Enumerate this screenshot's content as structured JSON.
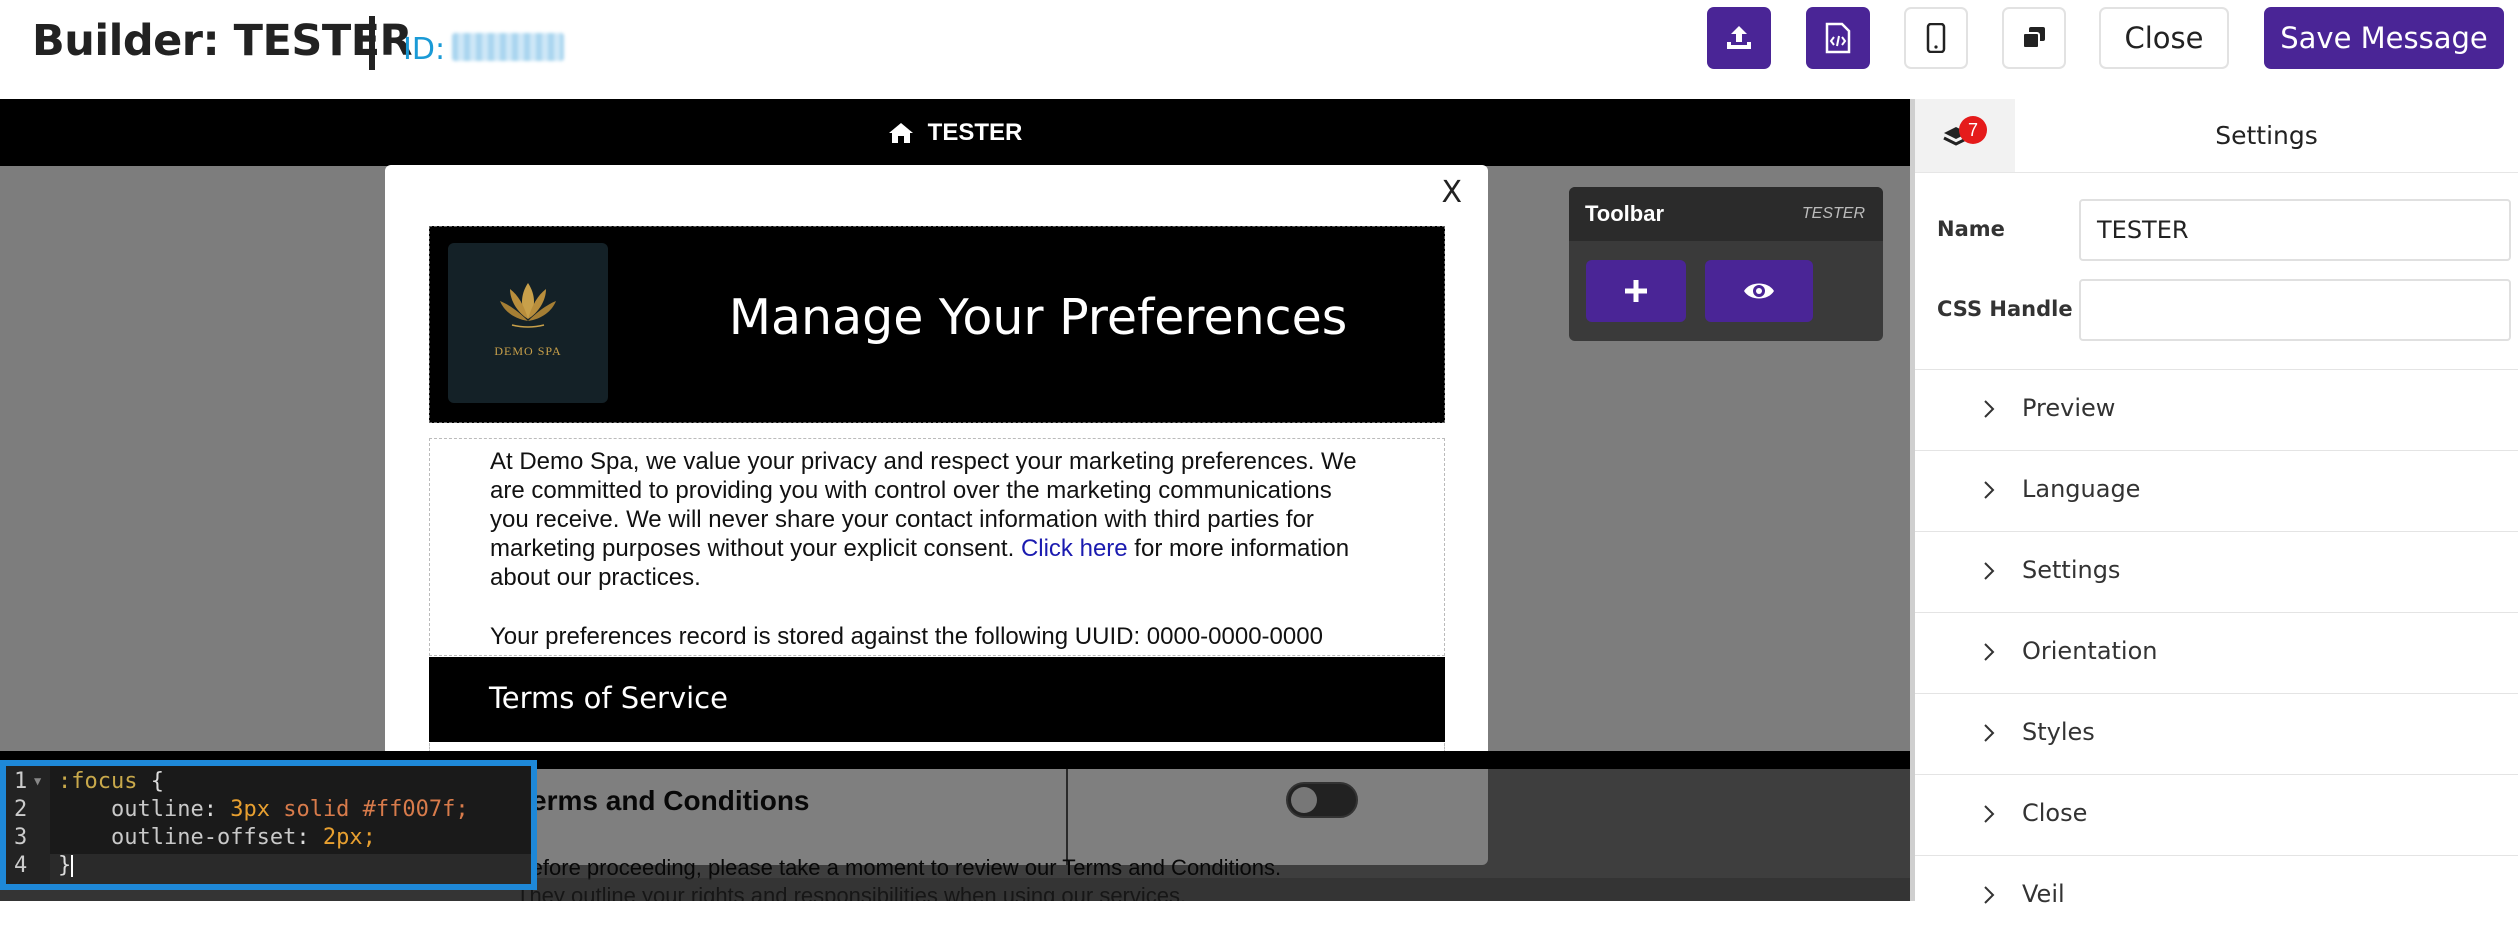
{
  "header": {
    "title": "Builder: TESTER",
    "id_label": "ID:",
    "close_label": "Close",
    "save_label": "Save Message",
    "icons": [
      "upload-icon",
      "code-file-icon",
      "mobile-icon",
      "copy-icon"
    ]
  },
  "canvas": {
    "topbar_title": "TESTER",
    "modal": {
      "close_x": "X",
      "hero_title": "Manage Your Preferences",
      "logo_text": "DEMO SPA",
      "intro_lines": [
        "At Demo Spa, we value your privacy and respect your marketing preferences. We",
        "are committed to providing you with control over the marketing communications",
        "you receive. We will never share your contact information with third parties for",
        "marketing purposes without your explicit consent."
      ],
      "link_text": "Click here",
      "after_link": " for more information",
      "intro_last": "about our practices.",
      "uuid_text": "Your preferences record is stored against the following UUID: 0000-0000-0000",
      "tos_heading": "Terms of Service",
      "tc_title": "Terms and Conditions",
      "tc_line1": "Before proceeding, please take a moment to review our Terms and Conditions.",
      "tc_line2": "They outline your rights and responsibilities when using our services."
    },
    "toolbar": {
      "title": "Toolbar",
      "subtitle": "TESTER"
    }
  },
  "code_editor": {
    "line_numbers": [
      "1",
      "2",
      "3",
      "4"
    ],
    "selector": ":focus",
    "open_brace": " {",
    "prop1": "outline",
    "val1_num": "3px",
    "val1_rest": "solid #ff007f;",
    "prop2": "outline-offset",
    "val2_num": "2px;",
    "close_brace": "}"
  },
  "settings_panel": {
    "badge_count": "7",
    "title": "Settings",
    "name_label": "Name",
    "name_value": "TESTER",
    "css_handle_label": "CSS Handle",
    "css_handle_value": "",
    "sections": [
      "Preview",
      "Language",
      "Settings",
      "Orientation",
      "Styles",
      "Close",
      "Veil"
    ]
  },
  "colors": {
    "accent": "#4a2596",
    "id_blue": "#1a9ad6",
    "badge_red": "#e51b1b",
    "editor_border": "#1e88d8"
  }
}
